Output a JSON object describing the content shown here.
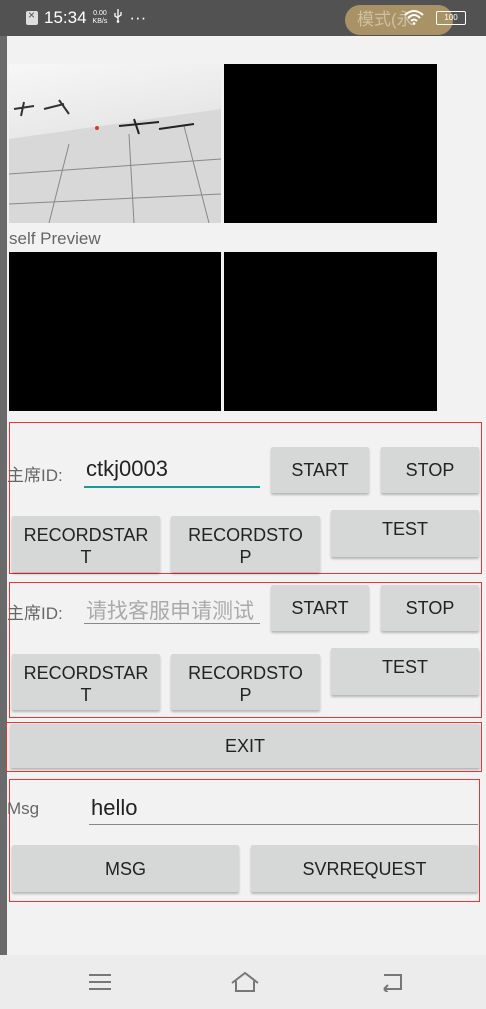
{
  "status_bar": {
    "time": "15:34",
    "net_speed_value": "0.00",
    "net_speed_unit": "KB/s",
    "usb_icon": "usb-icon",
    "more": "···",
    "mode_pill": "模式(永",
    "battery": "100"
  },
  "video": {
    "self_preview_label": "self Preview"
  },
  "section1": {
    "chair_label": "主席ID:",
    "chair_value": "ctkj0003",
    "start": "START",
    "stop": "STOP",
    "record_start_line1": "RECORDSTAR",
    "record_start_line2": "T",
    "record_stop_line1": "RECORDSTO",
    "record_stop_line2": "P",
    "test": "TEST"
  },
  "section2": {
    "chair_label": "主席ID:",
    "chair_placeholder": "请找客服申请测试",
    "start": "START",
    "stop": "STOP",
    "record_start_line1": "RECORDSTAR",
    "record_start_line2": "T",
    "record_stop_line1": "RECORDSTO",
    "record_stop_line2": "P",
    "test": "TEST"
  },
  "exit": "EXIT",
  "msg_section": {
    "label": "Msg",
    "value": "hello",
    "msg_button": "MSG",
    "svr_button": "SVRREQUEST"
  },
  "navigation": {
    "menu_icon": "menu-icon",
    "home_icon": "home-icon",
    "back_icon": "back-icon"
  },
  "colors": {
    "accent_underline": "#1a9a92",
    "border_red": "#e33333",
    "button_gray": "#d6d7d7"
  }
}
